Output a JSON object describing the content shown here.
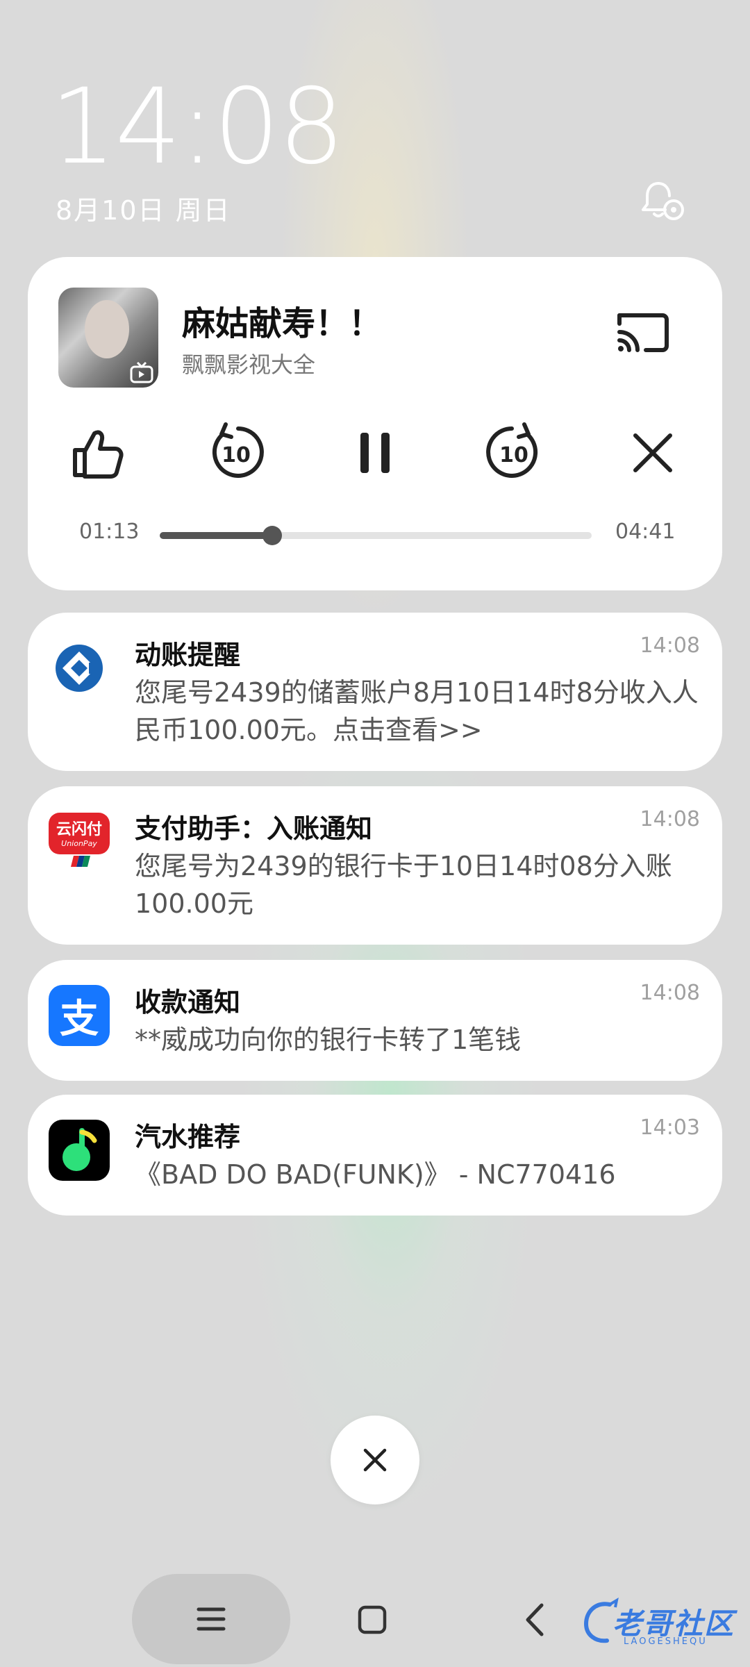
{
  "lockscreen": {
    "time": "14:08",
    "date": "8月10日 周日"
  },
  "media": {
    "title": "麻姑献寿！！",
    "source": "飘飘影视大全",
    "current_time": "01:13",
    "total_time": "04:41",
    "progress": 0.26,
    "icons": [
      "cast-icon",
      "like-icon",
      "rewind-10-icon",
      "pause-icon",
      "forward-10-icon",
      "close-icon"
    ],
    "rewind_label": "10",
    "forward_label": "10"
  },
  "notifications": [
    {
      "app": "ccb",
      "title": "动账提醒",
      "time": "14:08",
      "body": "您尾号2439的储蓄账户8月10日14时8分收入人民币100.00元。点击查看>>"
    },
    {
      "app": "unionpay",
      "title": "支付助手：入账通知",
      "time": "14:08",
      "body": "您尾号为2439的银行卡于10日14时08分入账100.00元",
      "icon_text": "云闪付",
      "icon_sub": "UnionPay"
    },
    {
      "app": "alipay",
      "title": "收款通知",
      "time": "14:08",
      "body": "**威成功向你的银行卡转了1笔钱",
      "icon_text": "支"
    },
    {
      "app": "qishui",
      "title": "汽水推荐",
      "time": "14:03",
      "body": "《BAD DO BAD(FUNK)》 - NC770416"
    }
  ],
  "watermark": {
    "text": "老哥社区",
    "sub": "LAOGESHEQU"
  },
  "colors": {
    "ccb_blue": "#1a64b4",
    "unionpay_red": "#e2242b",
    "alipay_blue": "#1677ff",
    "qishui_green": "#2de07a"
  }
}
